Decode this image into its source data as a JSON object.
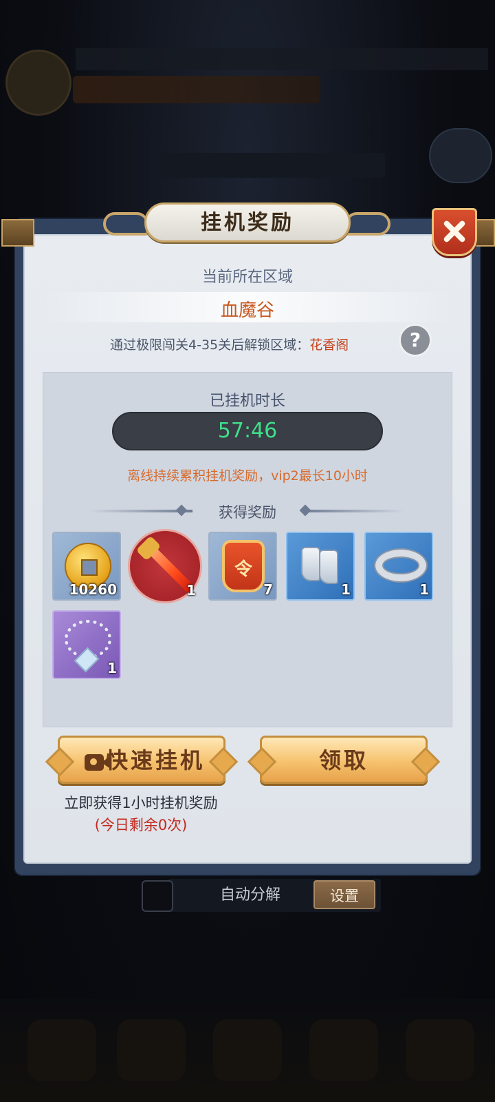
{
  "modal": {
    "title": "挂机奖励",
    "close_icon": "close-icon",
    "current_region_label": "当前所在区域",
    "current_region_name": "血魔谷",
    "unlock_text": "通过极限闯关4-35关后解锁区域：",
    "unlock_region": "花香阁",
    "help_label": "?",
    "duration_label": "已挂机时长",
    "duration_value": "57:46",
    "offline_note": "离线持续累积挂机奖励，vip2最长10小时",
    "rewards_title": "获得奖励",
    "rewards": [
      {
        "icon": "copper-coin-icon",
        "count": "10260"
      },
      {
        "icon": "flame-sword-icon",
        "count": "1"
      },
      {
        "icon": "command-token-icon",
        "token_char": "令",
        "count": "7"
      },
      {
        "icon": "boots-icon",
        "count": "1"
      },
      {
        "icon": "ring-icon",
        "count": "1"
      },
      {
        "icon": "necklace-icon",
        "count": "1"
      }
    ],
    "quick_button_label": "快速挂机",
    "quick_button_icon": "video-icon",
    "quick_desc": "立即获得1小时挂机奖励",
    "quick_remaining": "(今日剩余0次)",
    "claim_button_label": "领取"
  },
  "auto_decompose": {
    "label": "自动分解",
    "checked": false,
    "settings_label": "设置"
  },
  "colors": {
    "region_name": "#c8571e",
    "unlock_region": "#c3421a",
    "timer": "#3fe08a",
    "offline_note": "#d86a2c",
    "remaining": "#c3281e",
    "modal_frame": "#31435f"
  }
}
